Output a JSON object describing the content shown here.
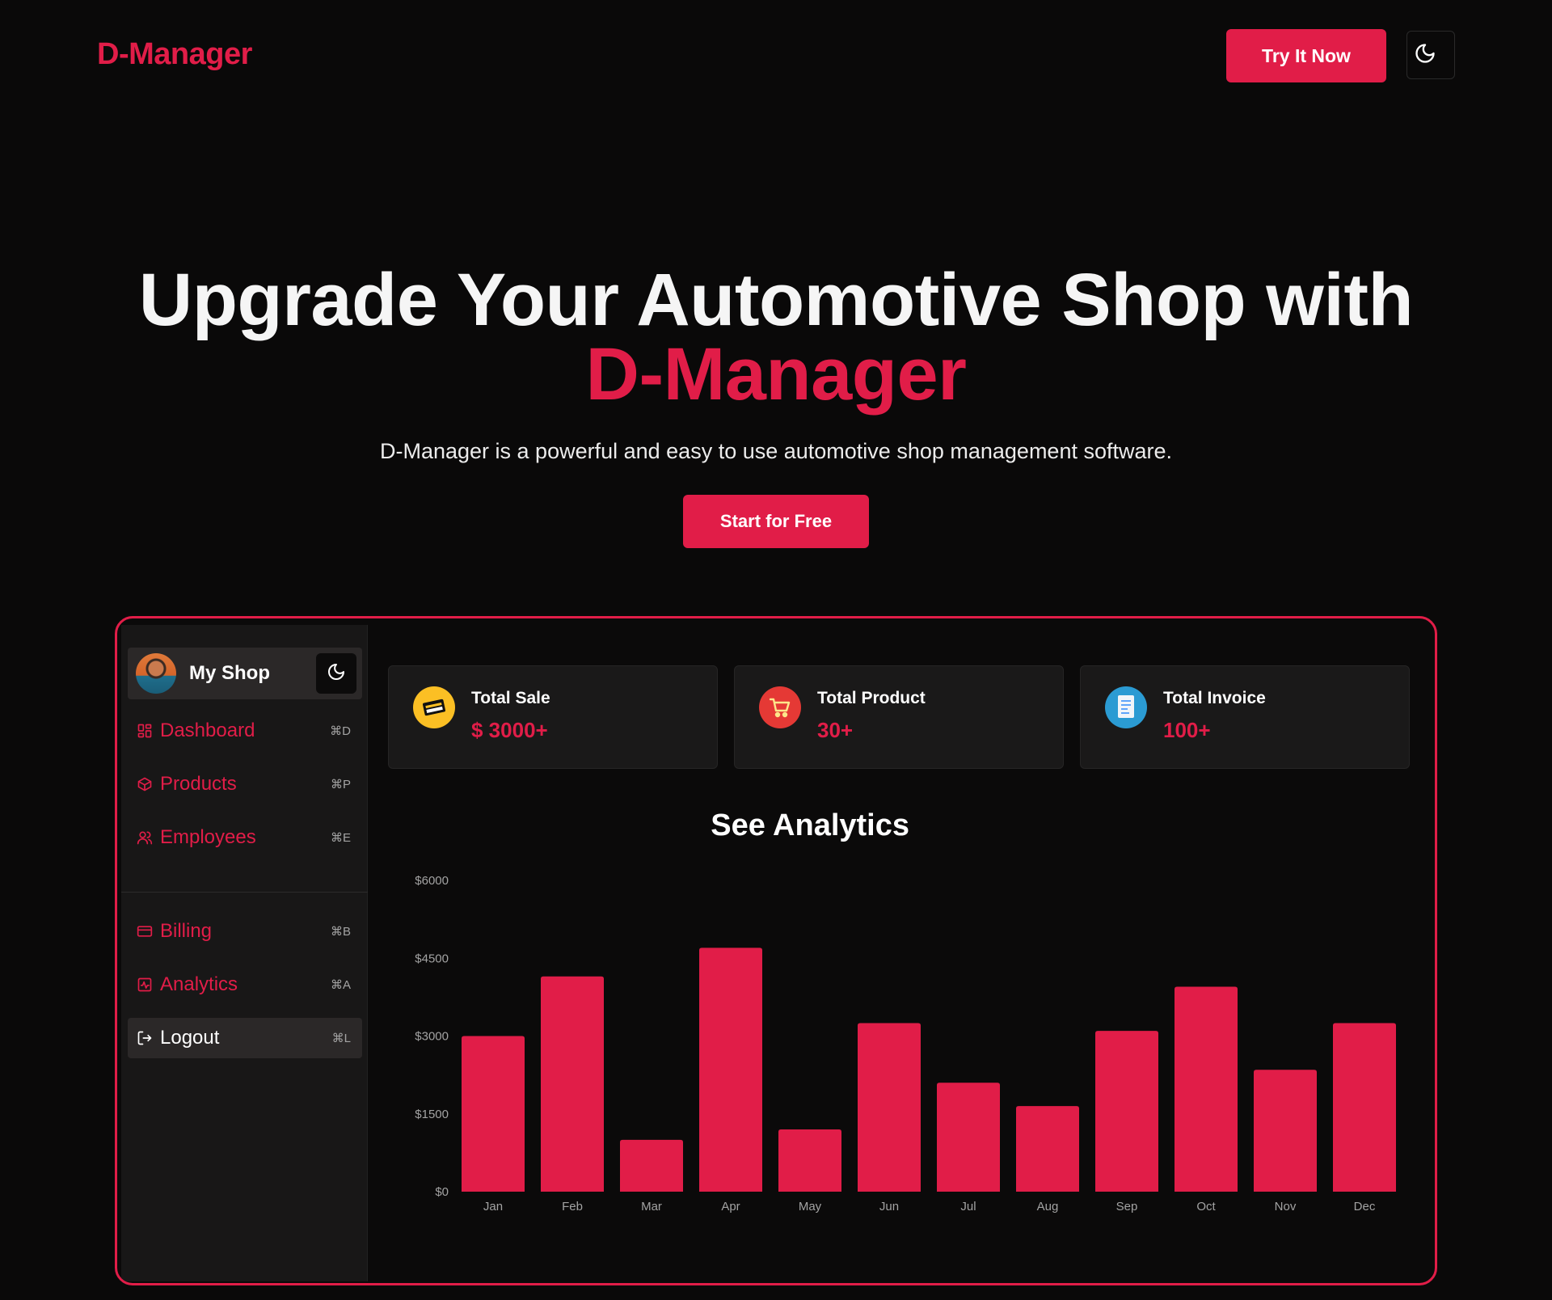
{
  "header": {
    "brand": "D-Manager",
    "try_label": "Try It Now"
  },
  "hero": {
    "title": "Upgrade Your Automotive Shop with",
    "title_accent": "D-Manager",
    "subtitle": "D-Manager is a powerful and easy to use automotive shop management software.",
    "cta_label": "Start for Free"
  },
  "sidebar": {
    "shop_name": "My Shop",
    "items": [
      {
        "label": "Dashboard",
        "shortcut": "⌘D",
        "icon": "dashboard-icon"
      },
      {
        "label": "Products",
        "shortcut": "⌘P",
        "icon": "package-icon"
      },
      {
        "label": "Employees",
        "shortcut": "⌘E",
        "icon": "users-icon"
      },
      {
        "label": "Billing",
        "shortcut": "⌘B",
        "icon": "credit-card-icon"
      },
      {
        "label": "Analytics",
        "shortcut": "⌘A",
        "icon": "analytics-icon"
      },
      {
        "label": "Logout",
        "shortcut": "⌘L",
        "icon": "logout-icon"
      }
    ]
  },
  "stats": [
    {
      "label": "Total Sale",
      "value": "$ 3000+",
      "icon": "sale-tag-icon"
    },
    {
      "label": "Total Product",
      "value": "30+",
      "icon": "shopping-cart-icon"
    },
    {
      "label": "Total Invoice",
      "value": "100+",
      "icon": "invoice-icon"
    }
  ],
  "colors": {
    "accent": "#e11d48",
    "background": "#0a0909",
    "card": "#1a1919"
  },
  "chart_data": {
    "type": "bar",
    "title": "See Analytics",
    "categories": [
      "Jan",
      "Feb",
      "Mar",
      "Apr",
      "May",
      "Jun",
      "Jul",
      "Aug",
      "Sep",
      "Oct",
      "Nov",
      "Dec"
    ],
    "values": [
      3000,
      4150,
      1000,
      4700,
      1200,
      3250,
      2100,
      1650,
      3100,
      3950,
      2350,
      3250
    ],
    "y_ticks": [
      "$0",
      "$1500",
      "$3000",
      "$4500",
      "$6000"
    ],
    "ylim": [
      0,
      6000
    ],
    "grid": false,
    "color": "#e11d48"
  }
}
